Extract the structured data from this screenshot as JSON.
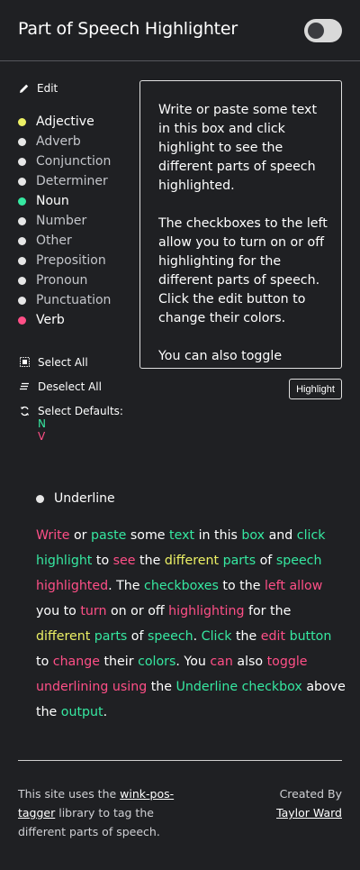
{
  "header": {
    "title": "Part of Speech Highlighter",
    "toggle_on": false
  },
  "edit": {
    "label": "Edit"
  },
  "pos_items": [
    {
      "label": "Adjective",
      "color": "#ecf065",
      "enabled": true
    },
    {
      "label": "Adverb",
      "color": "#e6e6e6",
      "enabled": false
    },
    {
      "label": "Conjunction",
      "color": "#e6e6e6",
      "enabled": false
    },
    {
      "label": "Determiner",
      "color": "#e6e6e6",
      "enabled": false
    },
    {
      "label": "Noun",
      "color": "#36e8a1",
      "enabled": true
    },
    {
      "label": "Number",
      "color": "#e6e6e6",
      "enabled": false
    },
    {
      "label": "Other",
      "color": "#e6e6e6",
      "enabled": false
    },
    {
      "label": "Preposition",
      "color": "#e6e6e6",
      "enabled": false
    },
    {
      "label": "Pronoun",
      "color": "#e6e6e6",
      "enabled": false
    },
    {
      "label": "Punctuation",
      "color": "#e6e6e6",
      "enabled": false
    },
    {
      "label": "Verb",
      "color": "#ff4f87",
      "enabled": true
    }
  ],
  "textbox": {
    "paragraphs": [
      "Write or paste some text in this box and click highlight to see the different parts of speech highlighted.",
      "The checkboxes to the left allow you to turn on or off highlighting for the different parts of speech. Click the edit button to change their colors.",
      "You can also toggle"
    ]
  },
  "highlight_button": {
    "label": "Highlight"
  },
  "controls": {
    "select_all": "Select All",
    "deselect_all": "Deselect All",
    "select_defaults": "Select Defaults:",
    "defaults_n": "N",
    "defaults_v": "V"
  },
  "underline": {
    "label": "Underline"
  },
  "output_tokens": [
    [
      "Write",
      "v"
    ],
    [
      " or ",
      ""
    ],
    [
      "paste",
      "n"
    ],
    [
      " some ",
      ""
    ],
    [
      "text",
      "n"
    ],
    [
      " in this ",
      ""
    ],
    [
      "box",
      "n"
    ],
    [
      " and ",
      ""
    ],
    [
      "click",
      "n"
    ],
    [
      " ",
      ""
    ],
    [
      "highlight",
      "n"
    ],
    [
      " to ",
      ""
    ],
    [
      "see",
      "v"
    ],
    [
      " the ",
      ""
    ],
    [
      "different",
      "a"
    ],
    [
      " ",
      ""
    ],
    [
      "parts",
      "n"
    ],
    [
      " of ",
      ""
    ],
    [
      "speech",
      "n"
    ],
    [
      " ",
      ""
    ],
    [
      "highlighted",
      "v"
    ],
    [
      ". The ",
      ""
    ],
    [
      "checkboxes",
      "n"
    ],
    [
      " to the ",
      ""
    ],
    [
      "left",
      "v"
    ],
    [
      " ",
      ""
    ],
    [
      "allow",
      "v"
    ],
    [
      " ",
      ""
    ],
    [
      "you to ",
      ""
    ],
    [
      "turn",
      "v"
    ],
    [
      " on or off ",
      ""
    ],
    [
      "highlighting",
      "v"
    ],
    [
      " for the ",
      ""
    ],
    [
      "different",
      "a"
    ],
    [
      " ",
      ""
    ],
    [
      "parts",
      "n"
    ],
    [
      " of ",
      ""
    ],
    [
      "speech",
      "n"
    ],
    [
      ". ",
      ""
    ],
    [
      "Click",
      "n"
    ],
    [
      " the ",
      ""
    ],
    [
      "edit",
      "v"
    ],
    [
      " ",
      ""
    ],
    [
      "button",
      "n"
    ],
    [
      " ",
      ""
    ],
    [
      "to ",
      ""
    ],
    [
      "change",
      "v"
    ],
    [
      " their ",
      ""
    ],
    [
      "colors",
      "n"
    ],
    [
      ". You ",
      ""
    ],
    [
      "can",
      "v"
    ],
    [
      " also ",
      ""
    ],
    [
      "toggle",
      "v"
    ],
    [
      " ",
      ""
    ],
    [
      "underlining",
      "v"
    ],
    [
      " ",
      ""
    ],
    [
      "using",
      "v"
    ],
    [
      " the ",
      ""
    ],
    [
      "Underline",
      "n"
    ],
    [
      " ",
      ""
    ],
    [
      "checkbox",
      "n"
    ],
    [
      " ",
      ""
    ],
    [
      "above the ",
      ""
    ],
    [
      "output",
      "n"
    ],
    [
      ".",
      ""
    ]
  ],
  "footer": {
    "left_prefix": "This site uses the ",
    "left_link": "wink-pos-tagger",
    "left_suffix": " library to tag the different parts of speech.",
    "right_label": "Created By",
    "right_link": "Taylor Ward"
  }
}
